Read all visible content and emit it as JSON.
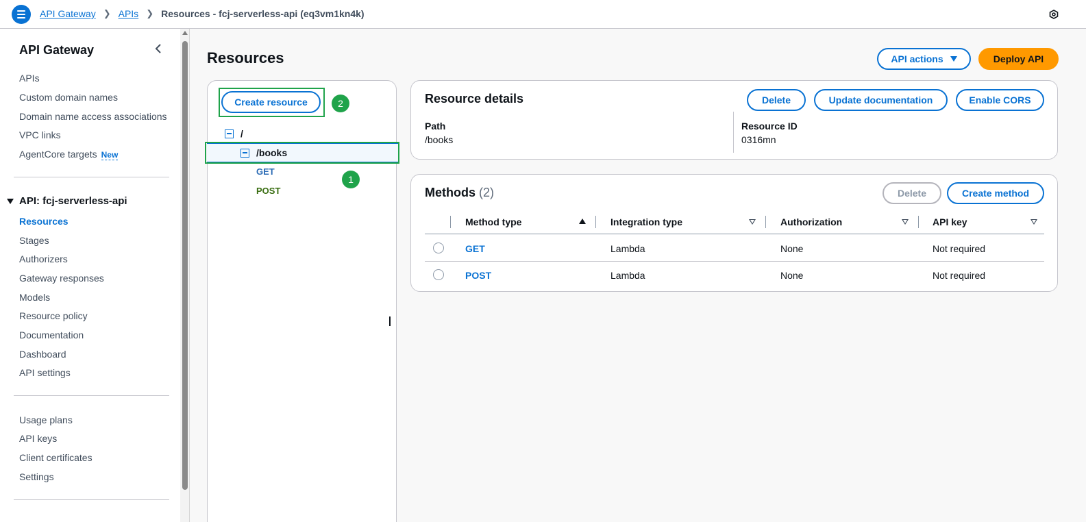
{
  "breadcrumb": {
    "items": [
      "API Gateway",
      "APIs"
    ],
    "current": "Resources - fcj-serverless-api (eq3vm1kn4k)"
  },
  "sidebar": {
    "title": "API Gateway",
    "top_items": [
      {
        "label": "APIs"
      },
      {
        "label": "Custom domain names"
      },
      {
        "label": "Domain name access associations"
      },
      {
        "label": "VPC links"
      },
      {
        "label": "AgentCore targets",
        "badge": "New"
      }
    ],
    "api_section": "API: fcj-serverless-api",
    "api_items": [
      {
        "label": "Resources",
        "active": true
      },
      {
        "label": "Stages"
      },
      {
        "label": "Authorizers"
      },
      {
        "label": "Gateway responses"
      },
      {
        "label": "Models"
      },
      {
        "label": "Resource policy"
      },
      {
        "label": "Documentation"
      },
      {
        "label": "Dashboard"
      },
      {
        "label": "API settings"
      }
    ],
    "bottom_items": [
      {
        "label": "Usage plans"
      },
      {
        "label": "API keys"
      },
      {
        "label": "Client certificates"
      },
      {
        "label": "Settings"
      }
    ]
  },
  "page": {
    "title": "Resources",
    "api_actions_label": "API actions",
    "deploy_label": "Deploy API"
  },
  "tree": {
    "create_resource_label": "Create resource",
    "badge_create": "2",
    "badge_books": "1",
    "root": "/",
    "child": "/books",
    "methods": [
      "GET",
      "POST"
    ]
  },
  "resource_details": {
    "title": "Resource details",
    "delete_label": "Delete",
    "update_doc_label": "Update documentation",
    "enable_cors_label": "Enable CORS",
    "path_label": "Path",
    "path_value": "/books",
    "id_label": "Resource ID",
    "id_value": "0316mn"
  },
  "methods": {
    "title": "Methods",
    "count": "(2)",
    "delete_label": "Delete",
    "create_label": "Create method",
    "columns": [
      "Method type",
      "Integration type",
      "Authorization",
      "API key"
    ],
    "rows": [
      {
        "method": "GET",
        "integration": "Lambda",
        "authorization": "None",
        "api_key": "Not required"
      },
      {
        "method": "POST",
        "integration": "Lambda",
        "authorization": "None",
        "api_key": "Not required"
      }
    ]
  },
  "colors": {
    "accent": "#0972d3",
    "primary_button": "#ff9900",
    "highlight": "#1fa34a"
  }
}
